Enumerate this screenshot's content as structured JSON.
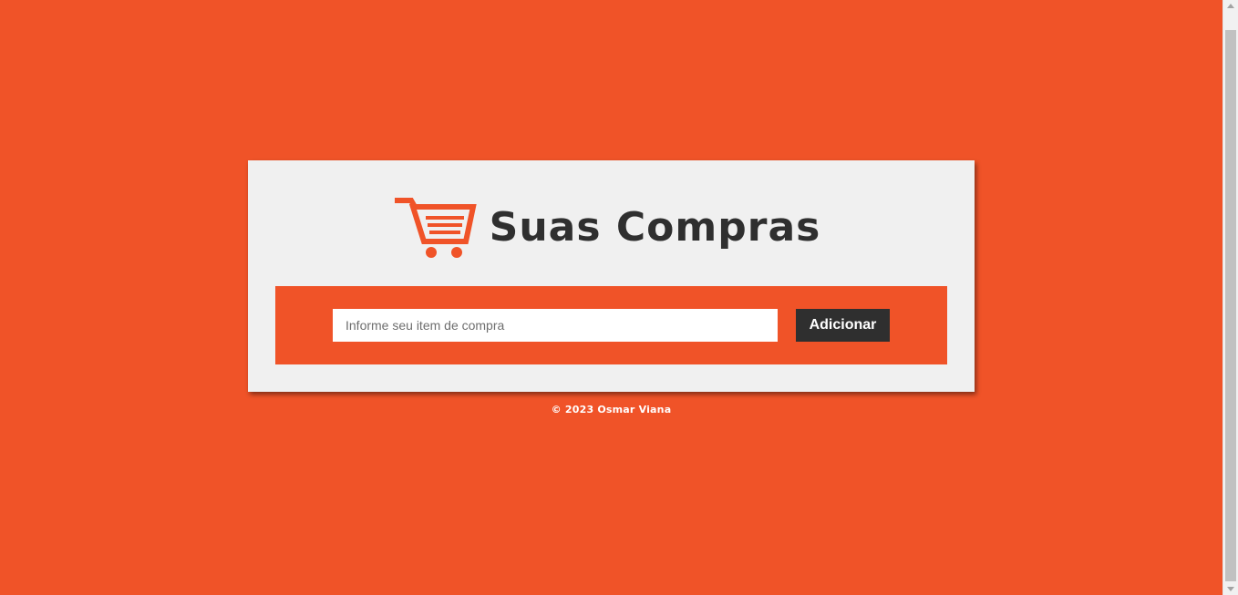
{
  "app": {
    "title": "Suas Compras",
    "logo_icon": "shopping-cart-icon"
  },
  "form": {
    "input_placeholder": "Informe seu item de compra",
    "input_value": "",
    "add_button_label": "Adicionar"
  },
  "footer": {
    "text": "© 2023 Osmar Viana"
  },
  "colors": {
    "background": "#f05328",
    "card": "#f0f0f0",
    "accent": "#f05328",
    "dark": "#2f2f2f"
  }
}
